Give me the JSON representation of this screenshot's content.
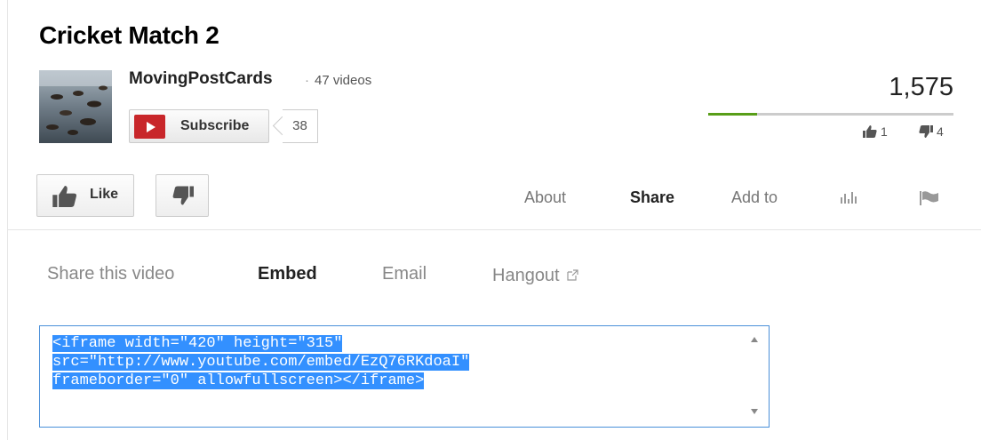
{
  "video": {
    "title": "Cricket Match 2",
    "views": "1,575",
    "like_ratio": 0.2
  },
  "channel": {
    "name": "MovingPostCards",
    "video_count": "47 videos",
    "separator": "·"
  },
  "subscribe": {
    "label": "Subscribe",
    "count": "38"
  },
  "ratings": {
    "likes": "1",
    "dislikes": "4"
  },
  "actions": {
    "like_label": "Like",
    "tabs": [
      "About",
      "Share",
      "Add to"
    ],
    "active_tab": "Share"
  },
  "share": {
    "tabs": [
      "Share this video",
      "Embed",
      "Email",
      "Hangout"
    ],
    "active_tab": "Embed"
  },
  "embed": {
    "lines": [
      "<iframe width=\"420\" height=\"315\"",
      "src=\"http://www.youtube.com/embed/EzQ76RKdoaI\"",
      "frameborder=\"0\" allowfullscreen></iframe>"
    ]
  },
  "colors": {
    "accent_green": "#589e18",
    "selection_blue": "#3390ff",
    "subscribe_red": "#c8262a"
  },
  "icons": [
    "youtube-play-icon",
    "thumbs-up-icon",
    "thumbs-down-icon",
    "stats-icon",
    "flag-icon",
    "external-link-icon"
  ]
}
